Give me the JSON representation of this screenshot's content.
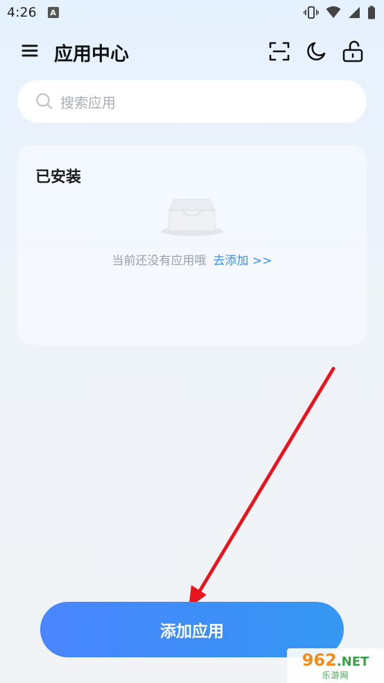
{
  "status_bar": {
    "time": "4:26",
    "notification_badge": "A"
  },
  "header": {
    "title": "应用中心",
    "icons": [
      "menu-icon",
      "scan-icon",
      "moon-icon",
      "unlock-icon"
    ]
  },
  "search": {
    "placeholder": "搜索应用"
  },
  "installed": {
    "title": "已安装",
    "empty_text": "当前还没有应用哦",
    "add_link": "去添加 >>"
  },
  "primary_action": {
    "label": "添加应用"
  },
  "watermark": {
    "top": "962",
    "top_suffix": ".NET",
    "bottom": "乐游网"
  },
  "colors": {
    "accent": "#3a8fe6",
    "button_start": "#4a85ff",
    "button_end": "#3598f2",
    "annotation_arrow": "#e8141e"
  }
}
